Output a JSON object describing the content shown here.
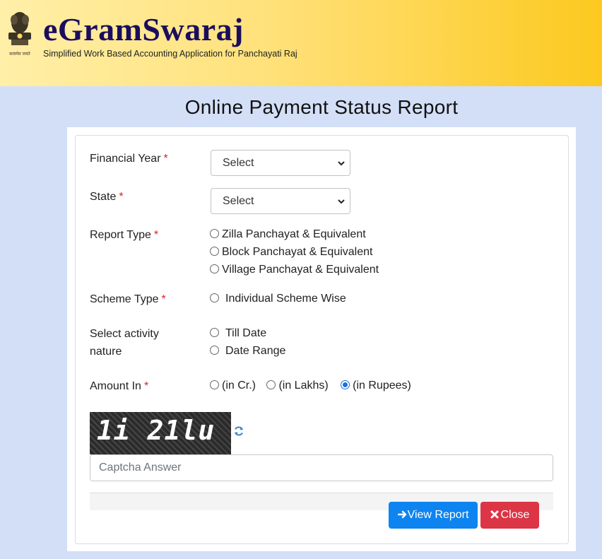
{
  "header": {
    "emblem_caption": "सत्यमेव जयते",
    "title": "eGramSwaraj",
    "subtitle": "Simplified Work Based Accounting Application for Panchayati Raj"
  },
  "page_title": "Online Payment Status Report",
  "form": {
    "financial_year": {
      "label": "Financial Year",
      "required": "*",
      "selected": "Select"
    },
    "state": {
      "label": "State",
      "required": "*",
      "selected": "Select"
    },
    "report_type": {
      "label": "Report Type",
      "required": "*",
      "options": [
        "Zilla Panchayat & Equivalent",
        "Block Panchayat & Equivalent",
        "Village Panchayat & Equivalent"
      ]
    },
    "scheme_type": {
      "label": "Scheme Type",
      "required": "*",
      "options": [
        "Individual Scheme Wise"
      ]
    },
    "activity_nature": {
      "label_line1": "Select activity",
      "label_line2": "nature",
      "options": [
        "Till Date",
        "Date Range"
      ]
    },
    "amount_in": {
      "label": "Amount In",
      "required": "*",
      "options": [
        "(in Cr.)",
        "(in Lakhs)",
        "(in Rupees)"
      ],
      "selected": "(in Rupees)"
    },
    "captcha": {
      "text": "1i 21lu",
      "placeholder": "Captcha Answer"
    }
  },
  "buttons": {
    "view_report": "View Report",
    "close": "Close"
  },
  "colors": {
    "header_gradient_start": "#ffefa8",
    "header_gradient_end": "#fcc91f",
    "brand_title": "#1a0d5e",
    "background": "#d3dff7",
    "required_mark": "#d9232d",
    "primary_button": "#0d84f0",
    "danger_button": "#dc3545",
    "radio_selected": "#1a6fe0"
  },
  "icons": {
    "emblem": "ashoka-emblem-icon",
    "select_arrow": "chevron-down-icon",
    "refresh": "refresh-icon",
    "view_report": "arrow-right-icon",
    "close": "close-icon"
  }
}
